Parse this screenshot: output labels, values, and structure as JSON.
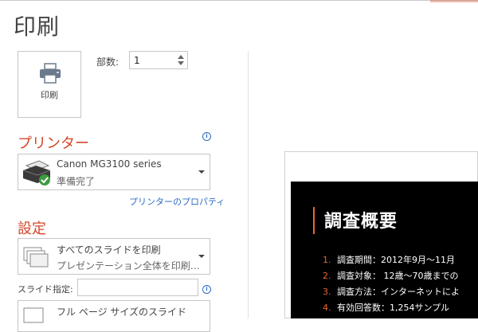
{
  "page": {
    "title": "印刷"
  },
  "print_button": {
    "label": "印刷",
    "icon": "printer-icon"
  },
  "copies": {
    "label": "部数:",
    "value": "1"
  },
  "printer_section": {
    "title": "プリンター",
    "selected_printer": {
      "name": "Canon MG3100 series",
      "status": "準備完了"
    },
    "properties_link": "プリンターのプロパティ"
  },
  "settings_section": {
    "title": "設定",
    "range": {
      "line1": "すべてのスライドを印刷",
      "line2": "プレゼンテーション全体を印刷…"
    },
    "slide_spec": {
      "label": "スライド指定:",
      "value": ""
    },
    "layout": {
      "line1": "フル ページ サイズのスライド"
    }
  },
  "preview": {
    "slide_title": "調査概要",
    "items": [
      {
        "num": "1.",
        "text": "調査期間：2012年9月～11月"
      },
      {
        "num": "2.",
        "text": "調査対象： 12歳～70歳までの"
      },
      {
        "num": "3.",
        "text": "調査方法：インターネットによ"
      },
      {
        "num": "4.",
        "text": "有効回答数：1,254サンプル"
      }
    ]
  },
  "colors": {
    "accent": "#d24726",
    "link": "#2b6cc4",
    "slide_accent": "#e8652f"
  }
}
